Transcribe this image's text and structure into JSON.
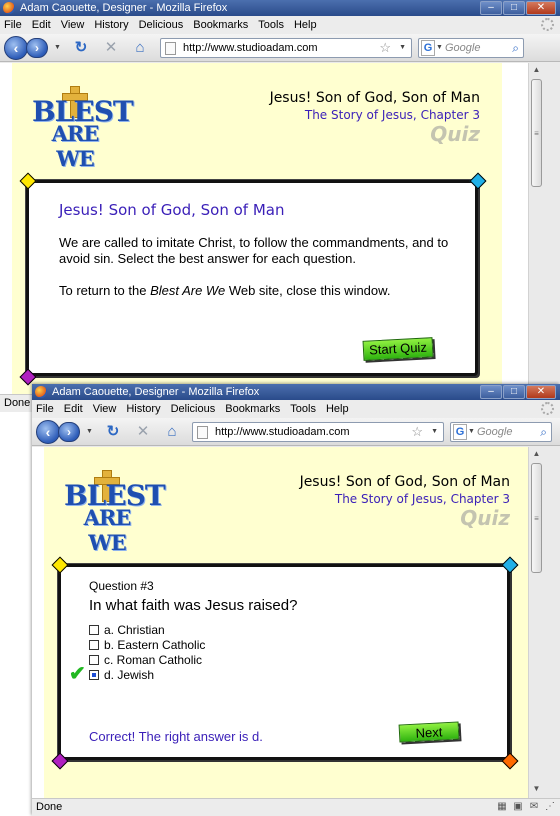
{
  "window1": {
    "title": "Adam Caouette, Designer - Mozilla Firefox",
    "menu": [
      "File",
      "Edit",
      "View",
      "History",
      "Delicious",
      "Bookmarks",
      "Tools",
      "Help"
    ],
    "url": "http://www.studioadam.com",
    "search_placeholder": "Google",
    "status_text": "Done",
    "logo": {
      "line1": "BLEST",
      "line2": "ARE WE"
    },
    "header": {
      "title": "Jesus! Son of God, Son of Man",
      "subtitle": "The Story of Jesus, Chapter 3",
      "quiz": "Quiz"
    },
    "card": {
      "title": "Jesus! Son of God, Son of Man",
      "para1": "We are called to imitate Christ, to follow the commandments, and to avoid sin. Select the best answer for each question.",
      "para2_pre": "To return to the ",
      "para2_em": "Blest Are We",
      "para2_post": " Web site, close this window.",
      "button": "Start Quiz"
    }
  },
  "window2": {
    "title": "Adam Caouette, Designer - Mozilla Firefox",
    "menu": [
      "File",
      "Edit",
      "View",
      "History",
      "Delicious",
      "Bookmarks",
      "Tools",
      "Help"
    ],
    "url": "http://www.studioadam.com",
    "search_placeholder": "Google",
    "status_text": "Done",
    "logo": {
      "line1": "BLEST",
      "line2": "ARE WE"
    },
    "header": {
      "title": "Jesus! Son of God, Son of Man",
      "subtitle": "The Story of Jesus, Chapter 3",
      "quiz": "Quiz"
    },
    "question": {
      "number": "Question #3",
      "text": "In what faith was Jesus raised?",
      "options": [
        {
          "label": "a. Christian",
          "selected": false
        },
        {
          "label": "b. Eastern Catholic",
          "selected": false
        },
        {
          "label": "c. Roman Catholic",
          "selected": false
        },
        {
          "label": "d. Jewish",
          "selected": true
        }
      ],
      "feedback": "Correct! The right answer is d.",
      "button": "Next"
    }
  },
  "colors": {
    "page_bg": "#ffffd0",
    "title_purple": "#3a1fb8",
    "button_green": "#4cd22a",
    "correct_check": "#21b821"
  },
  "icons": [
    "firefox-icon",
    "back-icon",
    "forward-icon",
    "reload-icon",
    "stop-icon",
    "home-icon",
    "page-icon",
    "bookmark-star-icon",
    "google-icon",
    "magnifier-icon",
    "activity-spinner-icon"
  ]
}
